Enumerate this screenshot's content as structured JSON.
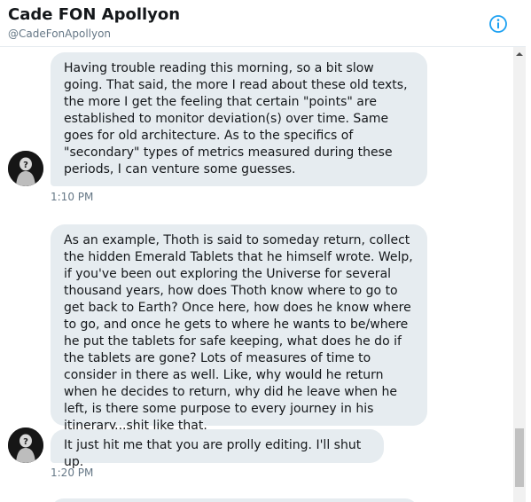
{
  "header": {
    "title": "Cade FON Apollyon",
    "handle": "@CadeFonApollyon",
    "info_icon": "info-circle-icon",
    "accent_color": "#1da1f2"
  },
  "messages": [
    {
      "text": "Having trouble reading this morning, so a bit slow going. That said, the more I read about these old texts, the more I get the feeling that certain \"points\" are established to monitor deviation(s) over time. Same goes for old architecture. As to the specifics of \"secondary\" types of metrics measured during these periods, I can venture some guesses.",
      "timestamp": "1:10 PM"
    },
    {
      "text": "As an example, Thoth is said to someday return, collect the hidden Emerald Tablets that he himself wrote. Welp, if you've been out exploring the Universe for several thousand years, how does Thoth know where to go to get back to Earth? Once here, how does he know where to go, and once he gets to where he wants to be/where he put the tablets for safe keeping, what does he do if the tablets are gone? Lots of measures of time to consider in there as well. Like, why would he return when he decides to return, why did he leave when he left, is there some purpose to every journey in his itinerary...shit like that."
    },
    {
      "text": "It just hit me that you are prolly editing. I'll shut up.",
      "timestamp": "1:20 PM"
    }
  ],
  "colors": {
    "bubble_bg": "#e6ecf0",
    "timestamp": "#657786",
    "text": "#14171a"
  }
}
